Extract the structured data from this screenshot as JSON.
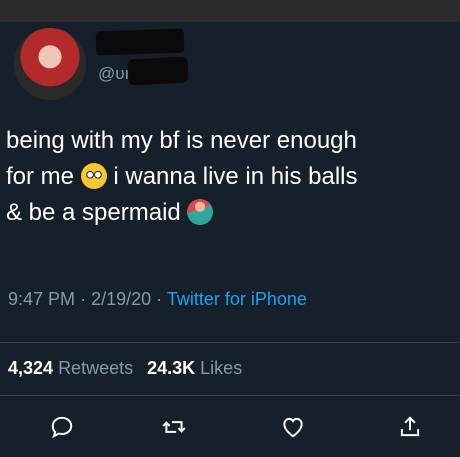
{
  "tweet": {
    "display_name": "",
    "handle": "@υı",
    "text_line1": "being with my bf is never enough",
    "text_line2a": "for me",
    "text_line2b": "i wanna live in his balls",
    "text_line3a": "& be a spermaid",
    "time": "9:47 PM",
    "sep": "·",
    "date": "2/19/20",
    "source": "Twitter for iPhone",
    "retweets_count": "4,324",
    "retweets_label": "Retweets",
    "likes_count": "24.3K",
    "likes_label": "Likes"
  },
  "icons": {
    "avatar": "avatar-photo",
    "emoji1": "face-with-rolling-eyes",
    "emoji2": "mermaid",
    "reply": "reply-icon",
    "retweet": "retweet-icon",
    "like": "heart-icon",
    "share": "share-icon"
  },
  "colors": {
    "background": "#15202b",
    "text": "#ffffff",
    "secondary": "#8899a6",
    "link": "#1da1f2"
  }
}
